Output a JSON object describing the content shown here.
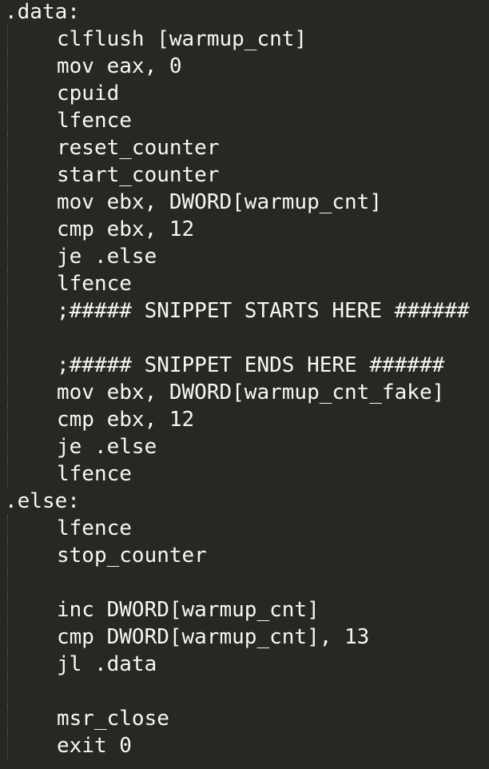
{
  "editor": {
    "background": "#272822",
    "text_color": "#f8f8f2",
    "lines": [
      {
        "text": ".data:",
        "indent": 0
      },
      {
        "text": "clflush [warmup_cnt]",
        "indent": 1
      },
      {
        "text": "mov eax, 0",
        "indent": 1
      },
      {
        "text": "cpuid",
        "indent": 1
      },
      {
        "text": "lfence",
        "indent": 1
      },
      {
        "text": "reset_counter",
        "indent": 1
      },
      {
        "text": "start_counter",
        "indent": 1
      },
      {
        "text": "mov ebx, DWORD[warmup_cnt]",
        "indent": 1
      },
      {
        "text": "cmp ebx, 12",
        "indent": 1
      },
      {
        "text": "je .else",
        "indent": 1
      },
      {
        "text": "lfence",
        "indent": 1
      },
      {
        "text": ";##### SNIPPET STARTS HERE ######",
        "indent": 1
      },
      {
        "text": "",
        "indent": 1
      },
      {
        "text": ";##### SNIPPET ENDS HERE ######",
        "indent": 1
      },
      {
        "text": "mov ebx, DWORD[warmup_cnt_fake]",
        "indent": 1
      },
      {
        "text": "cmp ebx, 12",
        "indent": 1
      },
      {
        "text": "je .else",
        "indent": 1
      },
      {
        "text": "lfence",
        "indent": 1
      },
      {
        "text": ".else:",
        "indent": 0
      },
      {
        "text": "lfence",
        "indent": 1
      },
      {
        "text": "stop_counter",
        "indent": 1
      },
      {
        "text": "",
        "indent": 1
      },
      {
        "text": "inc DWORD[warmup_cnt]",
        "indent": 1
      },
      {
        "text": "cmp DWORD[warmup_cnt], 13",
        "indent": 1
      },
      {
        "text": "jl .data",
        "indent": 1
      },
      {
        "text": "",
        "indent": 1
      },
      {
        "text": "msr_close",
        "indent": 1
      },
      {
        "text": "exit 0",
        "indent": 1
      }
    ]
  }
}
